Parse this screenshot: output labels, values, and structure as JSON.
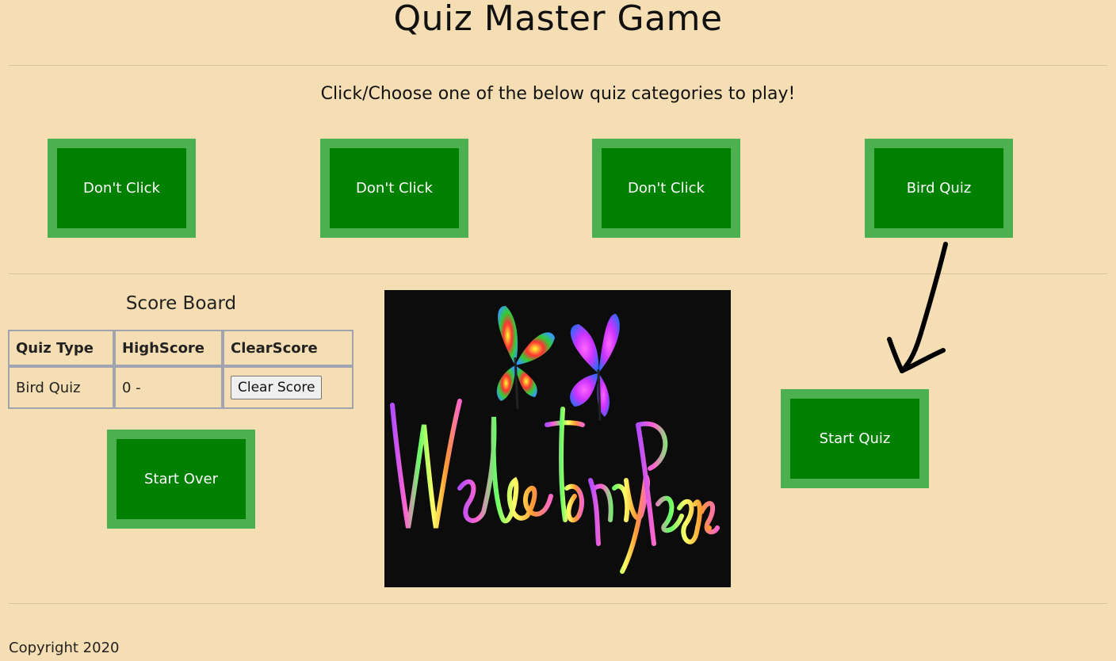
{
  "header": {
    "title": "Quiz Master Game",
    "subtitle": "Click/Choose one of the below quiz categories to play!"
  },
  "categories": [
    {
      "label": "Don't Click"
    },
    {
      "label": "Don't Click"
    },
    {
      "label": "Don't Click"
    },
    {
      "label": "Bird Quiz"
    }
  ],
  "scoreboard": {
    "title": "Score Board",
    "columns": [
      "Quiz Type",
      "HighScore",
      "ClearScore"
    ],
    "rows": [
      {
        "quiz_type": "Bird Quiz",
        "high_score": "0 -",
        "clear_label": "Clear Score"
      }
    ]
  },
  "buttons": {
    "start_over": "Start Over",
    "start_quiz": "Start Quiz"
  },
  "welcome_image": {
    "text": "Welcome to my Page.."
  },
  "footer": {
    "copyright": "Copyright 2020"
  },
  "colors": {
    "background": "#f5deb3",
    "button_fill": "#008000",
    "button_border": "#4caf50"
  }
}
